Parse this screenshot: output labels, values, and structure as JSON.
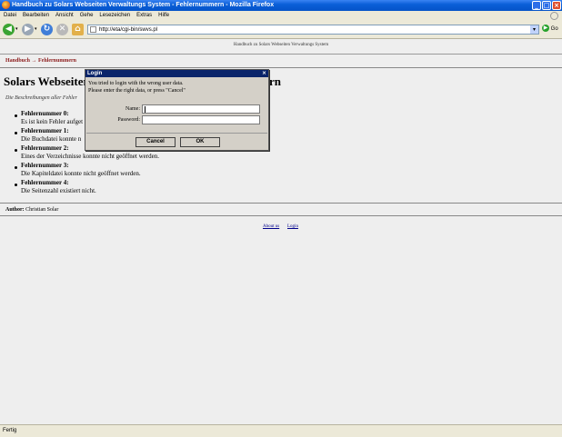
{
  "window": {
    "title": "Handbuch zu Solars Webseiten Verwaltungs System - Fehlernummern - Mozilla Firefox",
    "buttons": {
      "minimize": "_",
      "maximize": "□",
      "close": "×"
    }
  },
  "menu": [
    "Datei",
    "Bearbeiten",
    "Ansicht",
    "Gehe",
    "Lesezeichen",
    "Extras",
    "Hilfe"
  ],
  "toolbar": {
    "icons": [
      "back-arrow-icon",
      "forward-arrow-icon",
      "reload-icon",
      "stop-icon",
      "home-icon"
    ],
    "url": "http://eta/cgi-bin/swvs.pl",
    "go_label": "Go"
  },
  "page": {
    "header": "Handbuch zu Solars Webseiten Verwaltungs System",
    "breadcrumb": "Handbuch → Fehlernummern",
    "title": "Solars Webseiten",
    "title_tail": "rn",
    "intro": "Die Beschreibungen aller Fehler",
    "errors": [
      {
        "name": "Fehlernummer 0:",
        "desc": "Es ist kein Fehler aufget"
      },
      {
        "name": "Fehlernummer 1:",
        "desc": "Die Buchdatei konnte n"
      },
      {
        "name": "Fehlernummer 2:",
        "desc": "Eines der Verzeichnisse konnte nicht geöffnet werden."
      },
      {
        "name": "Fehlernummer 3:",
        "desc": "Die Kapiteldatei konnte nicht geöffnet werden."
      },
      {
        "name": "Fehlernummer 4:",
        "desc": "Die Seitenzahl existiert nicht."
      }
    ],
    "author_label": "Author:",
    "author_name": "Christian Solar",
    "footer_links": [
      "About us",
      "Login"
    ]
  },
  "dialog": {
    "title": "Login",
    "close": "×",
    "message_line1": "You tried to login with the wrong user data.",
    "message_line2": "Please enter the right data, or press \"Cancel\"",
    "name_label": "Name:",
    "name_value": "",
    "password_label": "Password:",
    "password_value": "",
    "cancel_label": "Cancel",
    "ok_label": "OK"
  },
  "status": "Fertig"
}
